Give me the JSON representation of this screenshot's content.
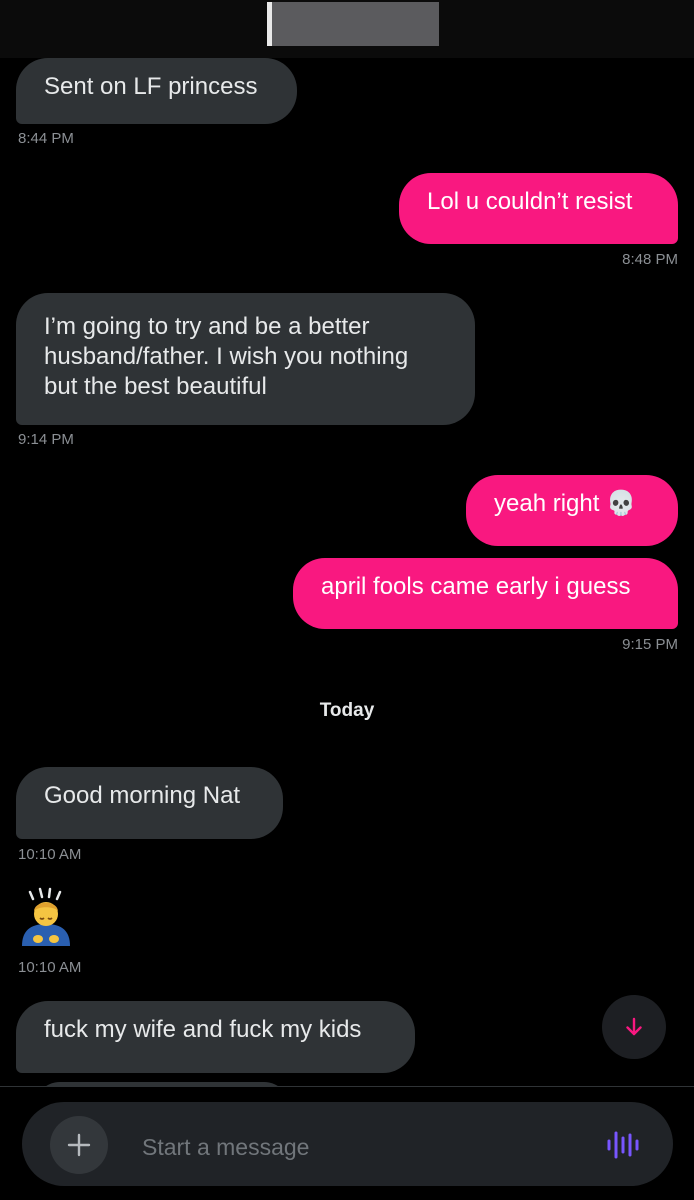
{
  "colors": {
    "background": "#000000",
    "incoming_bubble": "#2f3336",
    "outgoing_bubble": "#f91880",
    "accent_voice": "#7856ff",
    "timestamp": "#8b8f94"
  },
  "messages": [
    {
      "direction": "incoming",
      "text": "Sent on LF princess",
      "time": "8:44 PM"
    },
    {
      "direction": "outgoing",
      "text": "Lol u couldn’t resist",
      "time": "8:48 PM"
    },
    {
      "direction": "incoming",
      "text": "I’m going to try and be a better husband/father. I wish you nothing but the best beautiful",
      "time": "9:14 PM"
    },
    {
      "direction": "outgoing",
      "text": "yeah right 💀",
      "time": ""
    },
    {
      "direction": "outgoing",
      "text": "april fools came early i guess",
      "time": "9:15 PM"
    },
    {
      "direction": "incoming",
      "text": "Good morning Nat",
      "time": "10:10 AM"
    },
    {
      "direction": "incoming",
      "emoji": "person-bowing-emoji",
      "time": "10:10 AM"
    },
    {
      "direction": "incoming",
      "text": "fuck my wife and fuck my kids",
      "time": ""
    }
  ],
  "day_divider": "Today",
  "composer": {
    "placeholder": "Start a message",
    "add_icon": "plus-icon",
    "voice_icon": "voice-waveform-icon"
  },
  "scroll_down_icon": "arrow-down-icon"
}
